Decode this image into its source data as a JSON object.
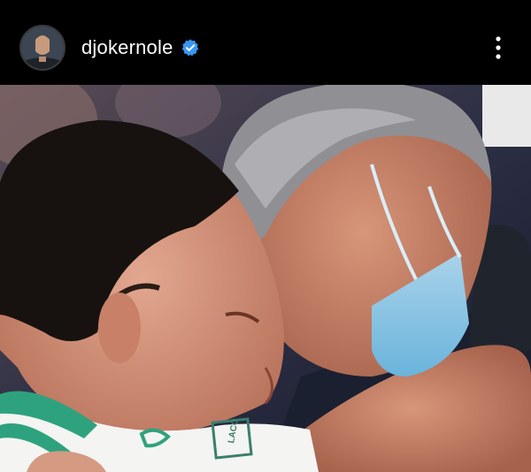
{
  "post": {
    "username": "djokernole",
    "verified": true,
    "avatar_icon": "profile-avatar",
    "verified_icon": "verified-badge-icon",
    "more_icon": "more-vertical-icon"
  },
  "photo": {
    "shirt_text": "LACO",
    "accent_color": "#2ea27e"
  },
  "colors": {
    "background": "#000000",
    "verified_blue": "#3897f0",
    "text": "#ffffff"
  }
}
